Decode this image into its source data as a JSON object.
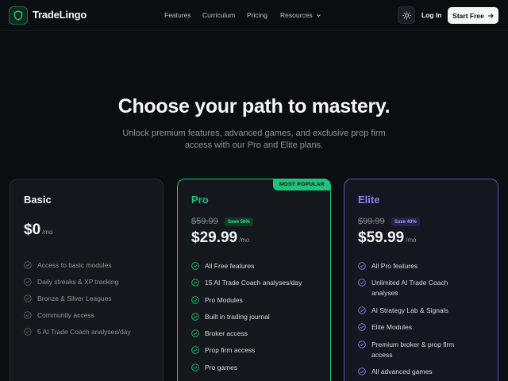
{
  "nav": {
    "logo_icon": "shield-icon",
    "brand": "TradeLingo",
    "links": [
      "Features",
      "Curriculum",
      "Pricing",
      "Resources"
    ],
    "resources_icon": "chevron-down-icon",
    "theme_icon": "sun-icon",
    "login": "Log In",
    "start_free": "Start Free",
    "start_icon": "arrow-right-icon"
  },
  "hero": {
    "title": "Choose your path to mastery.",
    "subtitle": "Unlock premium features, advanced games, and exclusive prop firm access with our Pro and Elite plans."
  },
  "plans": {
    "basic": {
      "name": "Basic",
      "price": "$0",
      "period": "/mo",
      "features": [
        "Access to basic modules",
        "Daily streaks & XP tracking",
        "Bronze & Silver Leagues",
        "Community access",
        "5 AI Trade Coach analyses/day"
      ]
    },
    "pro": {
      "badge": "MOST POPULAR",
      "name": "Pro",
      "old_price": "$59.99",
      "save": "Save 50%",
      "price": "$29.99",
      "period": "/mo",
      "features": [
        "All Free features",
        "15 AI Trade Coach analyses/day",
        "Pro Modules",
        "Built in trading journal",
        "Broker access",
        "Prop firm access",
        "Pro games"
      ]
    },
    "elite": {
      "name": "Elite",
      "old_price": "$99.99",
      "save": "Save 40%",
      "price": "$59.99",
      "period": "/mo",
      "features": [
        "All Pro features",
        "Unlimited AI Trade Coach analyses",
        "AI Strategy Lab & Signals",
        "Elite Modules",
        "Premium broker & prop firm access",
        "All advanced games"
      ]
    }
  },
  "colors": {
    "background": "#0b0e11",
    "card": "#14181d",
    "pro_accent": "#22c07a",
    "elite_accent": "#8b82f0",
    "muted_text": "#8d959e"
  }
}
